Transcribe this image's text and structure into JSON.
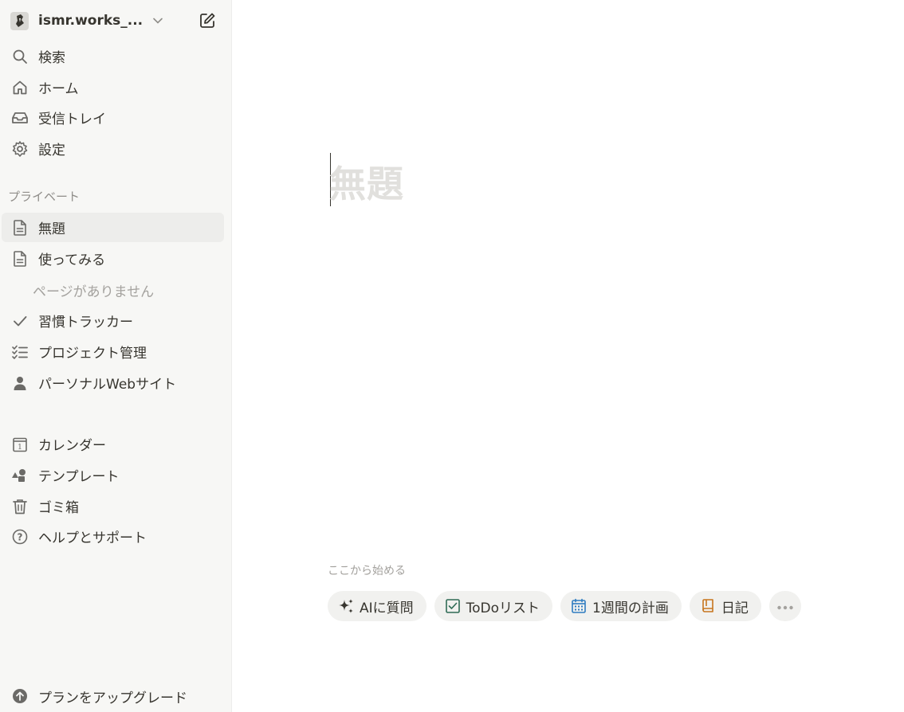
{
  "workspace": {
    "name": "ismr.works_..."
  },
  "nav_top": [
    {
      "label": "検索",
      "icon": "search-icon"
    },
    {
      "label": "ホーム",
      "icon": "home-icon"
    },
    {
      "label": "受信トレイ",
      "icon": "inbox-icon"
    },
    {
      "label": "設定",
      "icon": "gear-icon"
    }
  ],
  "private": {
    "section_label": "プライベート",
    "items": [
      {
        "label": "無題",
        "icon": "page-icon",
        "active": true
      },
      {
        "label": "使ってみる",
        "icon": "page-icon"
      }
    ],
    "empty_note": "ページがありません",
    "more_items": [
      {
        "label": "習慣トラッカー",
        "icon": "checkmark-icon"
      },
      {
        "label": "プロジェクト管理",
        "icon": "checklist-icon"
      },
      {
        "label": "パーソナルWebサイト",
        "icon": "person-icon"
      }
    ]
  },
  "nav_bottom": [
    {
      "label": "カレンダー",
      "icon": "calendar-icon"
    },
    {
      "label": "テンプレート",
      "icon": "shapes-icon"
    },
    {
      "label": "ゴミ箱",
      "icon": "trash-icon"
    },
    {
      "label": "ヘルプとサポート",
      "icon": "help-icon"
    }
  ],
  "upgrade": {
    "label": "プランをアップグレード"
  },
  "editor": {
    "title_placeholder": "無題",
    "start_label": "ここから始める",
    "chips": [
      {
        "label": "AIに質問",
        "icon": "sparkle-icon"
      },
      {
        "label": "ToDoリスト",
        "icon": "checkbox-icon"
      },
      {
        "label": "1週間の計画",
        "icon": "calendar-icon"
      },
      {
        "label": "日記",
        "icon": "book-icon"
      }
    ]
  },
  "colors": {
    "sidebar_bg": "#f7f7f5",
    "active_bg": "#ededeb",
    "chip_bg": "#f1f1ef",
    "placeholder": "#e1e0dd"
  }
}
